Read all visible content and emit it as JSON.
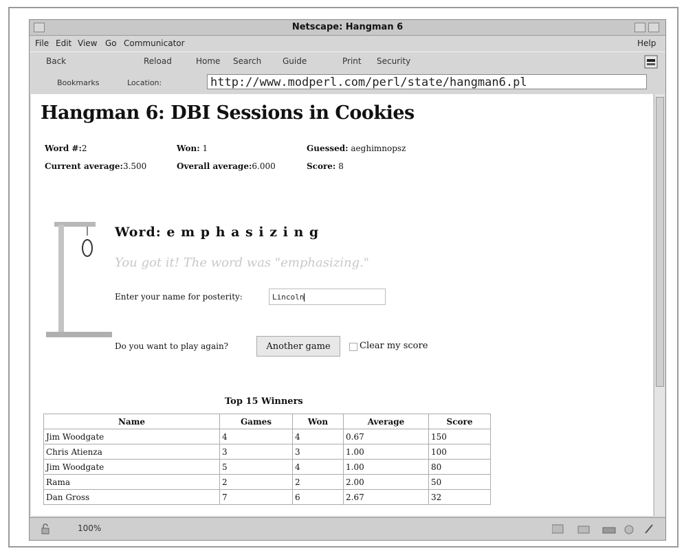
{
  "window": {
    "title": "Netscape: Hangman 6"
  },
  "menu": [
    "File",
    "Edit",
    "View",
    "Go",
    "Communicator",
    "Help"
  ],
  "toolbar": [
    "Back",
    "Reload",
    "Home",
    "Search",
    "Guide",
    "Print",
    "Security"
  ],
  "location": {
    "bookmarks_label": "Bookmarks",
    "location_label": "Location:",
    "url": "http://www.modperl.com/perl/state/hangman6.pl"
  },
  "page": {
    "title": "Hangman 6: DBI Sessions in Cookies",
    "stats": {
      "word_label": "Word #:",
      "word_value": "2",
      "won_label": "Won:",
      "won_value": "1",
      "guessed_label": "Guessed:",
      "guessed_value": "aeghimnopsz",
      "current_avg_label": "Current average:",
      "current_avg_value": "3.500",
      "overall_avg_label": "Overall average:",
      "overall_avg_value": "6.000",
      "score_label": "Score:",
      "score_value": "8"
    },
    "word_line": "Word: e m p h a s i z i n g",
    "win_message": "You got it! The word was \"emphasizing.\"",
    "posterity_label": "Enter your name for posterity:",
    "name_value": "Lincoln",
    "play_again_label": "Do you want to play again?",
    "another_game_label": "Another game",
    "clear_score_label": "Clear my score",
    "winners_title": "Top 15 Winners",
    "winners_columns": [
      "Name",
      "Games",
      "Won",
      "Average",
      "Score"
    ],
    "winners_rows": [
      [
        "Jim Woodgate",
        "4",
        "4",
        "0.67",
        "150"
      ],
      [
        "Chris Atienza",
        "3",
        "3",
        "1.00",
        "100"
      ],
      [
        "Jim Woodgate",
        "5",
        "4",
        "1.00",
        "80"
      ],
      [
        "Rama",
        "2",
        "2",
        "2.00",
        "50"
      ],
      [
        "Dan Gross",
        "7",
        "6",
        "2.67",
        "32"
      ]
    ]
  },
  "status": {
    "zoom": "100%"
  },
  "icons": {
    "gallows": "hangman-gallows-icon",
    "nav": "netscape-n-icon"
  }
}
